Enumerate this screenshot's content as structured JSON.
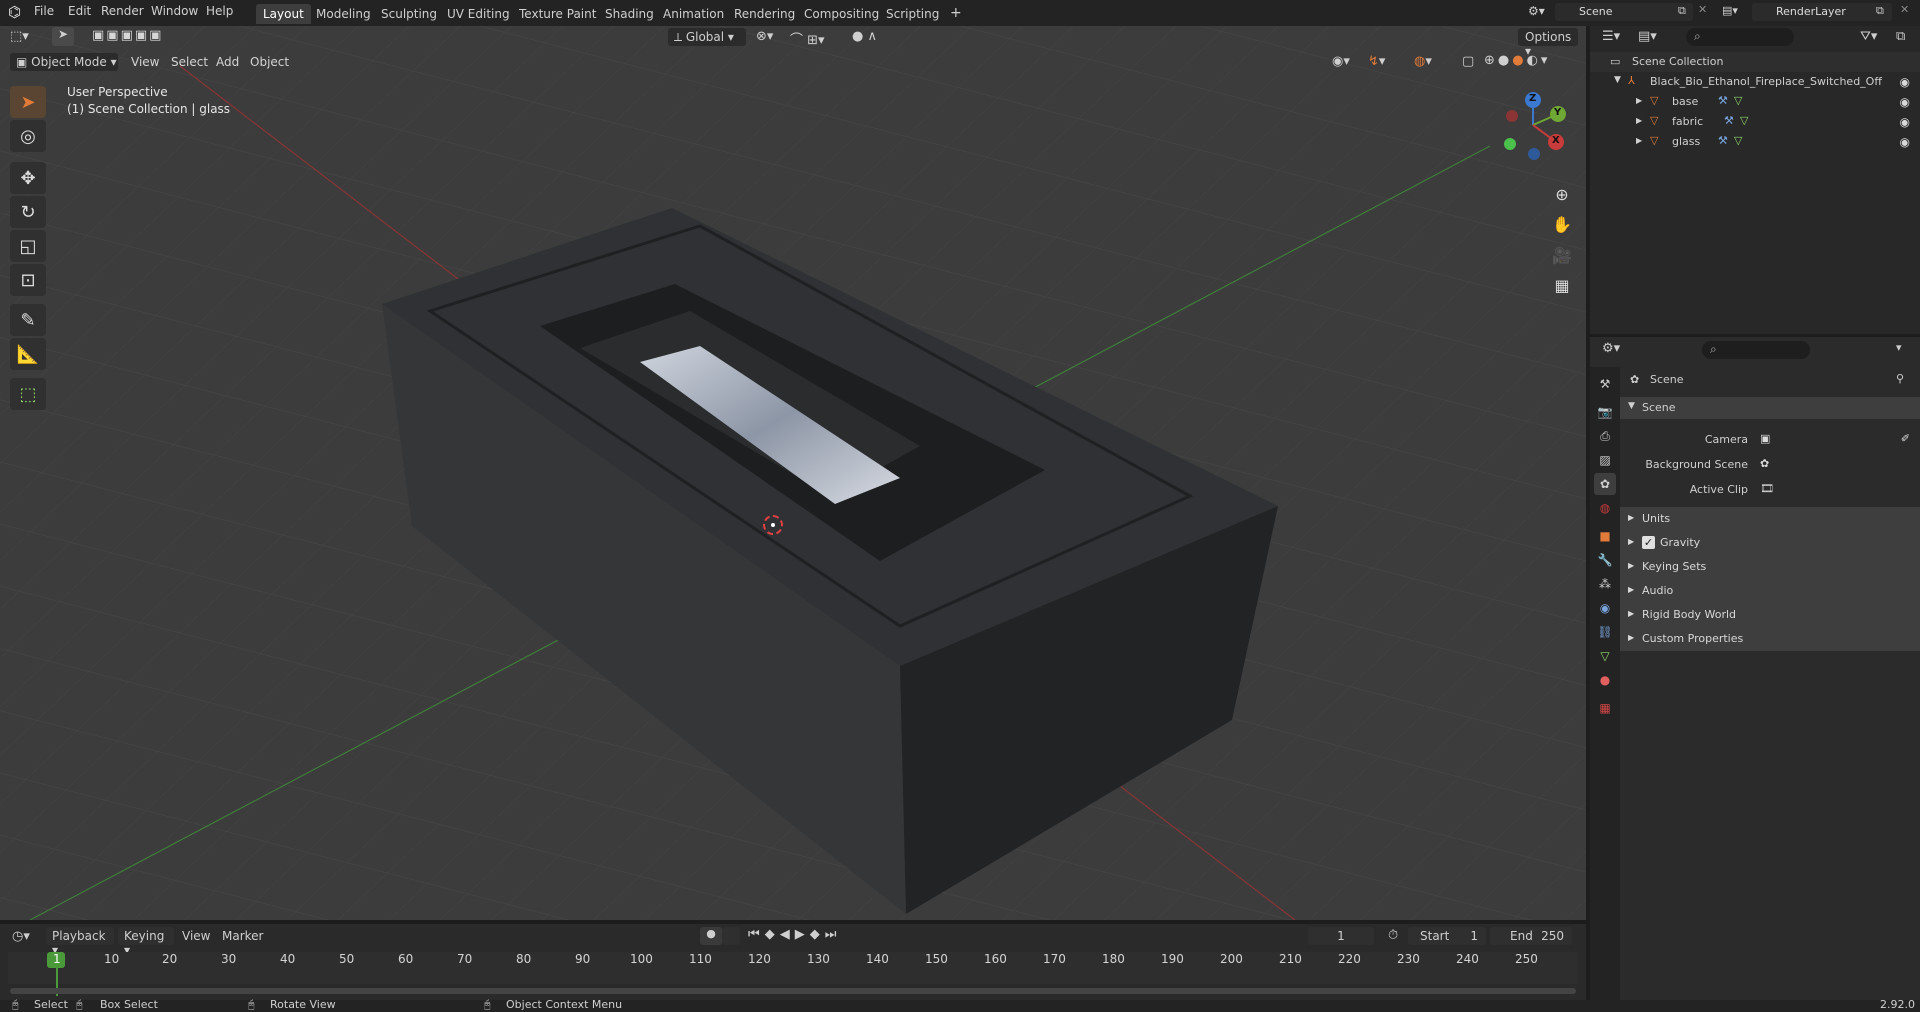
{
  "topbar": {
    "menus": [
      "File",
      "Edit",
      "Render",
      "Window",
      "Help"
    ],
    "workspaces": [
      "Layout",
      "Modeling",
      "Sculpting",
      "UV Editing",
      "Texture Paint",
      "Shading",
      "Animation",
      "Rendering",
      "Compositing",
      "Scripting"
    ],
    "active_workspace": "Layout",
    "add_tab": "+",
    "scene_name": "Scene",
    "view_layer": "RenderLayer"
  },
  "viewport": {
    "header": {
      "mode": "Object Mode",
      "menus": [
        "View",
        "Select",
        "Add",
        "Object"
      ],
      "transform_orientation": "Global",
      "options": "Options"
    },
    "overlay_text": {
      "perspective": "User Perspective",
      "collection": "(1) Scene Collection | glass"
    },
    "gizmo": {
      "z": "Z",
      "y": "Y",
      "x": "X"
    },
    "accent_colors": {
      "x_axis": "#c83b3b",
      "y_axis": "#6fa834",
      "z_axis": "#3b78d0",
      "active_tool": "#e07b39"
    }
  },
  "outliner": {
    "root": "Scene Collection",
    "collection": "Black_Bio_Ethanol_Fireplace_Switched_Off",
    "objects": [
      "base",
      "fabric",
      "glass"
    ]
  },
  "properties": {
    "context": "Scene",
    "panel": "Scene",
    "fields": [
      {
        "label": "Camera",
        "value": ""
      },
      {
        "label": "Background Scene",
        "value": ""
      },
      {
        "label": "Active Clip",
        "value": ""
      }
    ],
    "subpanels": [
      "Units",
      "Gravity",
      "Keying Sets",
      "Audio",
      "Rigid Body World",
      "Custom Properties"
    ],
    "gravity_checked": true
  },
  "timeline": {
    "menus": [
      "Playback",
      "Keying",
      "View",
      "Marker"
    ],
    "current_frame": "1",
    "start_label": "Start",
    "start": "1",
    "end_label": "End",
    "end": "250",
    "ruler": [
      "1",
      "10",
      "20",
      "30",
      "40",
      "50",
      "60",
      "70",
      "80",
      "90",
      "100",
      "110",
      "120",
      "130",
      "140",
      "150",
      "160",
      "170",
      "180",
      "190",
      "200",
      "210",
      "220",
      "230",
      "240",
      "250"
    ]
  },
  "statusbar": {
    "select": "Select",
    "box_select": "Box Select",
    "rotate_view": "Rotate View",
    "context_menu": "Object Context Menu",
    "version": "2.92.0"
  }
}
